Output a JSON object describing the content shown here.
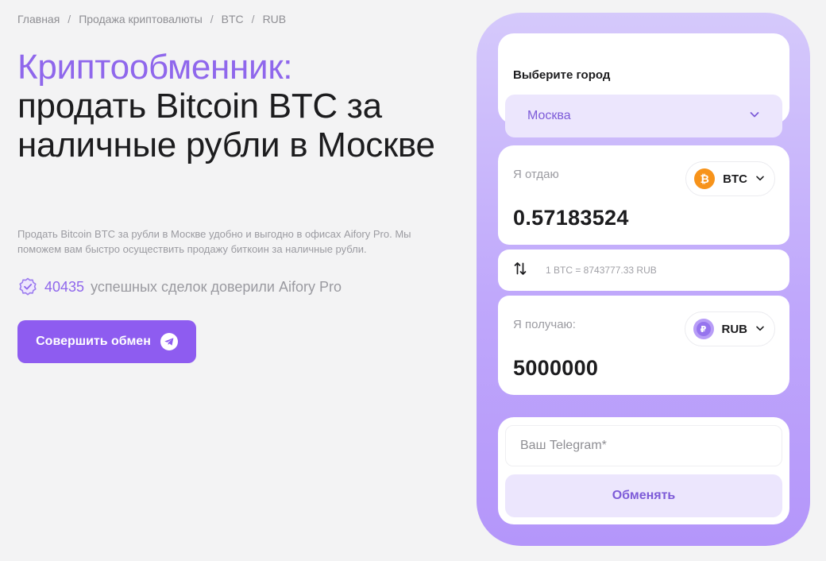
{
  "breadcrumb": {
    "items": [
      "Главная",
      "Продажа криптовалюты",
      "BTC",
      "RUB"
    ],
    "separator": "/"
  },
  "hero": {
    "title_accent": "Криптообменник:",
    "title_rest": "продать Bitcoin BTC за наличные рубли в Москве",
    "description": "Продать Bitcoin BTC за рубли в Москве удобно и выгодно в офисах Aifory Pro. Мы поможем вам быстро осуществить продажу биткоин за наличные рубли.",
    "stats_count": "40435",
    "stats_text": "успешных сделок доверили Aifory Pro",
    "cta_label": "Совершить обмен",
    "cta_icon": "telegram-icon"
  },
  "widget": {
    "city": {
      "label": "Выберите город",
      "selected": "Москва",
      "icon": "chevron-down-icon"
    },
    "give": {
      "label": "Я отдаю",
      "currency": "BTC",
      "amount": "0.57183524",
      "icon": "bitcoin-icon"
    },
    "rate": {
      "text": "1 BTC = 8743777.33 RUB",
      "icon": "swap-arrows-icon"
    },
    "receive": {
      "label": "Я получаю:",
      "currency": "RUB",
      "amount": "5000000",
      "icon": "ruble-icon"
    },
    "telegram_placeholder": "Ваш Telegram*",
    "submit_label": "Обменять"
  },
  "colors": {
    "accent": "#8f67ec",
    "cta_bg": "#8e5cf0",
    "btc_orange": "#f7931a",
    "widget_bg": "#c2acfb",
    "soft_purple": "#ece6fd"
  }
}
